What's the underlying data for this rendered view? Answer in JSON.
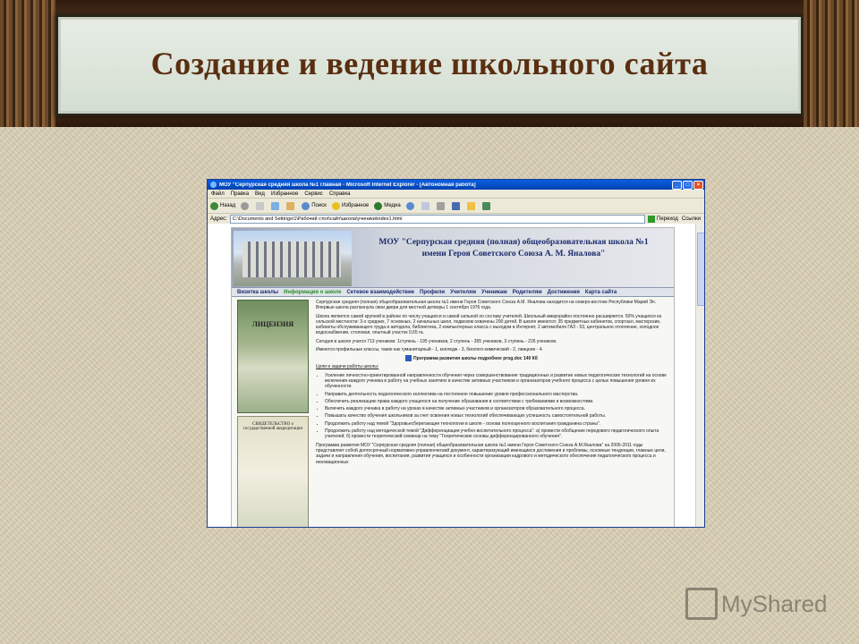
{
  "slide": {
    "title": "Создание и ведение школьного сайта"
  },
  "browser": {
    "window_title": "МОУ \"Серпурская средняя школа №1  главная - Microsoft Internet Explorer - [Автономная работа]",
    "menu": [
      "Файл",
      "Правка",
      "Вид",
      "Избранное",
      "Сервис",
      "Справка"
    ],
    "toolbar": {
      "back": "Назад",
      "search": "Поиск",
      "favorites": "Избранное",
      "media": "Медиа"
    },
    "address_label": "Адрес:",
    "address_value": "C:\\Documents and Settings\\1\\Рабочий стол\\сайт\\школа\\ученики\\index1.html",
    "go_label": "Переход",
    "links_label": "Ссылки"
  },
  "site": {
    "title": "МОУ \"Серпурская средняя (полная) общеобразовательная школа №1 имени Героя Советского Союза А. М. Яналова\"",
    "nav": [
      "Визитка школы",
      "Информация о школе",
      "Сетевое взаимодействие",
      "Профили",
      "Учителям",
      "Ученикам",
      "Родителям",
      "Достижения",
      "Карта сайта"
    ],
    "active_nav": "Информация о школе",
    "doc1_title": "ЛИЦЕНЗИЯ",
    "doc2_title": "СВИДЕТЕЛЬСТВО о государственной аккредитации",
    "paragraphs": [
      "Серпурская средняя (полная) общеобразовательная школа №1 имени Героя Советского Союза А.М. Яналова находится на северо-востоке Республики Марий Эл. Впервые школа распахнула свои двери для местной детворы 1 сентября 1976 года.",
      "Школа является самой крупной в районе по числу учащихся и самой сильной по составу учителей. Школьный микрорайон постоянно расширяется. 50% учащихся из сельской местности: 3-х средних, 7 основных, 2 начальных школ, подвозом охвачены 290 детей. В школе имеются: 35 предметных кабинетов, спортзал, мастерские, кабинеты обслуживающего труда и автодела, библиотека, 2 компьютерных класса с выходом в Интернет, 2 автомобиля ГАЗ - 53, центральное отопление, холодное водоснабжение, столовая, опытный участок 0,65 га.",
      "Сегодня в школе учатся 713 учеников: 1ступень - 195 учеников, 2 ступень - 355 учеников, 3 ступень - 226 учеников.",
      "Имеются профильные классы, такие как гуманитарный - 1, колледж - 3, биолого-химический - 2, лиицеин - 4."
    ],
    "program_link": "Программа развития школы подробнее prog.doc   140 Кб",
    "goals_heading": "Цели и задачи работы школы:",
    "goals": [
      "Усиление личностно-ориентированной направленности обучения через совершенствование традиционных и развитие новых педагогических технологий на основе включения каждого ученика в работу на учебных занятиях в качестве активных участников и организаторов учебного процесса с целью повышения уровня их обученности.",
      "Направить деятельность педагогического коллектива на постоянное повышение уровня профессионального мастерства.",
      "Обеспечить реализацию права каждого учащегося на получение образования в соответствии с требованиями и возможностями.",
      "Включить каждого ученика в работу на уроках в качестве активных участников и организаторов образовательного процесса.",
      "Повышать качество обучения школьников за счет освоения новых технологий обеспечивающих успешность самостоятельной работы.",
      "Продолжить работу над темой \"Здоровьесберегающие технологии в школе - основа полноценного воспитания гражданина страны\".",
      "Продолжить работу над методической темой \"Дифференциация учебно-воспитательного процесса\": а) провести обобщение передового педагогического опыта учителей; б) провести теоретический семинар на тему \"Теоретические основы дифференцированного обучения\"."
    ],
    "final_paragraph": "Программа развития МОУ \"Серпурская средняя (полная) общеобразовательная школа №1 имени Героя Советского Союза А.М.Яналова\" на 2006-2011 годы представляет собой долгосрочный нормативно-управленческий документ, характеризующий имеющиеся достижения и проблемы, основные тенденции, главные цели, задачи и направления обучения, воспитания, развития учащихся и особенности организации кадрового и методического обеспечения педагогического процесса и инновационных"
  },
  "watermark": "MyShared"
}
